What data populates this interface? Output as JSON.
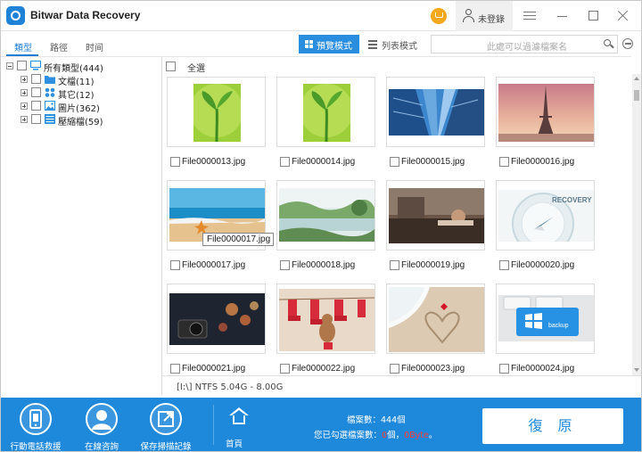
{
  "app": {
    "title": "Bitwar Data Recovery"
  },
  "titlebar": {
    "login": "未登錄"
  },
  "tabs": [
    "類型",
    "路徑",
    "时间"
  ],
  "view": {
    "preview_label": "預覽模式",
    "list_label": "列表模式"
  },
  "search": {
    "placeholder": "此處可以過濾檔案名"
  },
  "tree": {
    "root": {
      "label": "所有類型(444)"
    },
    "children": [
      {
        "label": "文檔(11)",
        "icon": "folder-icon",
        "color": "#2f8fe0"
      },
      {
        "label": "其它(12)",
        "icon": "apps-icon",
        "color": "#2f8fe0"
      },
      {
        "label": "圖片(362)",
        "icon": "image-icon",
        "color": "#2f8fe0"
      },
      {
        "label": "壓縮檔(59)",
        "icon": "archive-icon",
        "color": "#2f8fe0"
      }
    ]
  },
  "grid": {
    "select_all": "全選",
    "files": [
      {
        "name": "File0000013.jpg",
        "thumb": "sprout"
      },
      {
        "name": "File0000014.jpg",
        "thumb": "sprout"
      },
      {
        "name": "File0000015.jpg",
        "thumb": "skyscrapers"
      },
      {
        "name": "File0000016.jpg",
        "thumb": "eiffel-tower"
      },
      {
        "name": "File0000017.jpg",
        "thumb": "beach-starfish"
      },
      {
        "name": "File0000018.jpg",
        "thumb": "river-landscape"
      },
      {
        "name": "File0000019.jpg",
        "thumb": "office-desk"
      },
      {
        "name": "File0000020.jpg",
        "thumb": "recovery-compass"
      },
      {
        "name": "File0000021.jpg",
        "thumb": "camera-bokeh"
      },
      {
        "name": "File0000022.jpg",
        "thumb": "red-socks"
      },
      {
        "name": "File0000023.jpg",
        "thumb": "sand-heart"
      },
      {
        "name": "File0000024.jpg",
        "thumb": "backup-key"
      }
    ]
  },
  "tooltip": "File0000017.jpg",
  "status": {
    "drive": "[I:\\] NTFS 5.04G - 8.00G"
  },
  "bottom": {
    "btn_mobile": "行動電話救援",
    "btn_online": "在線咨詢",
    "btn_save": "保存掃描記錄",
    "home": "首頁",
    "count_label": "檔案數：444個",
    "selected_prefix": "您已勾選檔案數：",
    "selected_count": "0",
    "selected_mid": "個，",
    "selected_size": "0Byte",
    "selected_suffix": "。",
    "restore": "復 原"
  },
  "colors": {
    "accent": "#1e88db",
    "selected_highlight": "#ff3b3b",
    "cart": "#f4a81c"
  }
}
